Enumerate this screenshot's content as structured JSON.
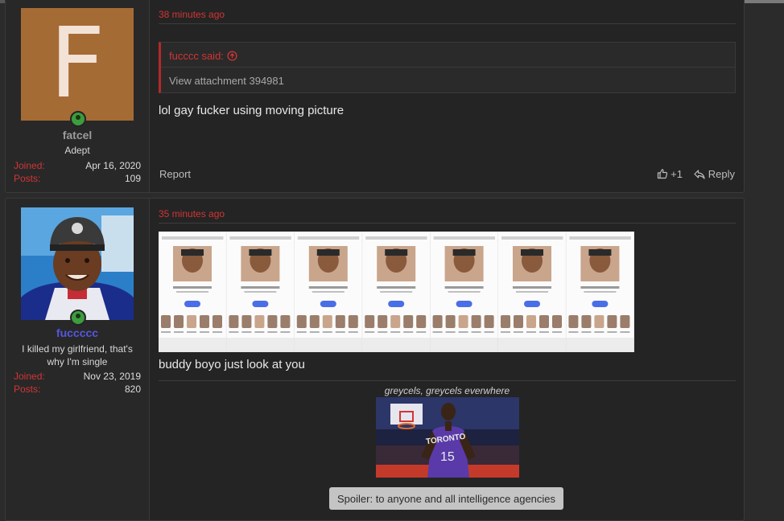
{
  "posts": [
    {
      "user": {
        "avatar_letter": "F",
        "name": "fatcel",
        "name_color": "#9a9a9a",
        "title": "Adept",
        "joined_label": "Joined:",
        "joined": "Apr 16, 2020",
        "posts_label": "Posts:",
        "posts": "109"
      },
      "time": "38 minutes ago",
      "quote": {
        "author": "fucccc said:",
        "body": "View attachment 394981"
      },
      "message": "lol gay fucker using moving picture",
      "footer": {
        "report": "Report",
        "like": "+1",
        "reply": "Reply"
      }
    },
    {
      "user": {
        "name": "fuccccc",
        "name_color": "#5656e0",
        "title": "I killed my girlfriend, that's why I'm single",
        "joined_label": "Joined:",
        "joined": "Nov 23, 2019",
        "posts_label": "Posts:",
        "posts": "820"
      },
      "time": "35 minutes ago",
      "message": "buddy boyo just look at you",
      "signature": {
        "caption": "greycels, greycels everwhere",
        "jersey_text": "TORONTO",
        "jersey_number": "15",
        "spoiler": "Spoiler: to anyone and all intelligence agencies"
      }
    }
  ],
  "colors": {
    "accent_red": "#d23535",
    "online_green": "#3d9c3d",
    "avatar_bg": "#a56b35"
  }
}
